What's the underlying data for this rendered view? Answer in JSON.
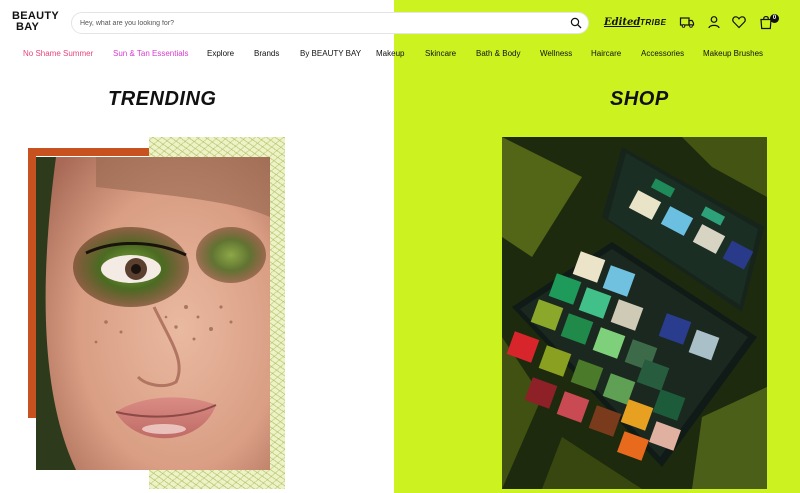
{
  "brand": {
    "logo_line1": "BEAUTY",
    "logo_line2": "BAY"
  },
  "search": {
    "placeholder": "Hey, what are you looking for?"
  },
  "header": {
    "edited_label": "Edited",
    "tribe_label": "TRIBE",
    "cart_count": "0"
  },
  "nav": {
    "items": [
      {
        "label": "No Shame Summer"
      },
      {
        "label": "Sun & Tan Essentials"
      },
      {
        "label": "Explore"
      },
      {
        "label": "Brands"
      },
      {
        "label": "By BEAUTY BAY"
      },
      {
        "label": "Makeup"
      },
      {
        "label": "Skincare"
      },
      {
        "label": "Bath & Body"
      },
      {
        "label": "Wellness"
      },
      {
        "label": "Haircare"
      },
      {
        "label": "Accessories"
      },
      {
        "label": "Makeup Brushes"
      }
    ]
  },
  "sections": {
    "trending_title": "TRENDING",
    "shop_title": "SHOP"
  },
  "colors": {
    "lime": "#ccf21f",
    "accent_pink": "#e8457a",
    "accent_magenta": "#d83bd0",
    "orange": "#c8521f"
  }
}
